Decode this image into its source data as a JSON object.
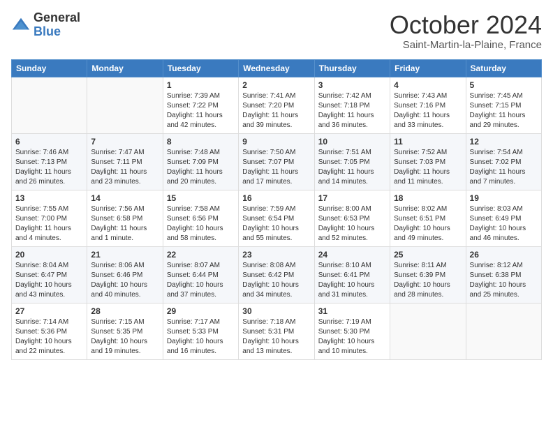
{
  "header": {
    "logo_general": "General",
    "logo_blue": "Blue",
    "month_title": "October 2024",
    "location": "Saint-Martin-la-Plaine, France"
  },
  "weekdays": [
    "Sunday",
    "Monday",
    "Tuesday",
    "Wednesday",
    "Thursday",
    "Friday",
    "Saturday"
  ],
  "weeks": [
    [
      {
        "day": "",
        "info": ""
      },
      {
        "day": "",
        "info": ""
      },
      {
        "day": "1",
        "info": "Sunrise: 7:39 AM\nSunset: 7:22 PM\nDaylight: 11 hours and 42 minutes."
      },
      {
        "day": "2",
        "info": "Sunrise: 7:41 AM\nSunset: 7:20 PM\nDaylight: 11 hours and 39 minutes."
      },
      {
        "day": "3",
        "info": "Sunrise: 7:42 AM\nSunset: 7:18 PM\nDaylight: 11 hours and 36 minutes."
      },
      {
        "day": "4",
        "info": "Sunrise: 7:43 AM\nSunset: 7:16 PM\nDaylight: 11 hours and 33 minutes."
      },
      {
        "day": "5",
        "info": "Sunrise: 7:45 AM\nSunset: 7:15 PM\nDaylight: 11 hours and 29 minutes."
      }
    ],
    [
      {
        "day": "6",
        "info": "Sunrise: 7:46 AM\nSunset: 7:13 PM\nDaylight: 11 hours and 26 minutes."
      },
      {
        "day": "7",
        "info": "Sunrise: 7:47 AM\nSunset: 7:11 PM\nDaylight: 11 hours and 23 minutes."
      },
      {
        "day": "8",
        "info": "Sunrise: 7:48 AM\nSunset: 7:09 PM\nDaylight: 11 hours and 20 minutes."
      },
      {
        "day": "9",
        "info": "Sunrise: 7:50 AM\nSunset: 7:07 PM\nDaylight: 11 hours and 17 minutes."
      },
      {
        "day": "10",
        "info": "Sunrise: 7:51 AM\nSunset: 7:05 PM\nDaylight: 11 hours and 14 minutes."
      },
      {
        "day": "11",
        "info": "Sunrise: 7:52 AM\nSunset: 7:03 PM\nDaylight: 11 hours and 11 minutes."
      },
      {
        "day": "12",
        "info": "Sunrise: 7:54 AM\nSunset: 7:02 PM\nDaylight: 11 hours and 7 minutes."
      }
    ],
    [
      {
        "day": "13",
        "info": "Sunrise: 7:55 AM\nSunset: 7:00 PM\nDaylight: 11 hours and 4 minutes."
      },
      {
        "day": "14",
        "info": "Sunrise: 7:56 AM\nSunset: 6:58 PM\nDaylight: 11 hours and 1 minute."
      },
      {
        "day": "15",
        "info": "Sunrise: 7:58 AM\nSunset: 6:56 PM\nDaylight: 10 hours and 58 minutes."
      },
      {
        "day": "16",
        "info": "Sunrise: 7:59 AM\nSunset: 6:54 PM\nDaylight: 10 hours and 55 minutes."
      },
      {
        "day": "17",
        "info": "Sunrise: 8:00 AM\nSunset: 6:53 PM\nDaylight: 10 hours and 52 minutes."
      },
      {
        "day": "18",
        "info": "Sunrise: 8:02 AM\nSunset: 6:51 PM\nDaylight: 10 hours and 49 minutes."
      },
      {
        "day": "19",
        "info": "Sunrise: 8:03 AM\nSunset: 6:49 PM\nDaylight: 10 hours and 46 minutes."
      }
    ],
    [
      {
        "day": "20",
        "info": "Sunrise: 8:04 AM\nSunset: 6:47 PM\nDaylight: 10 hours and 43 minutes."
      },
      {
        "day": "21",
        "info": "Sunrise: 8:06 AM\nSunset: 6:46 PM\nDaylight: 10 hours and 40 minutes."
      },
      {
        "day": "22",
        "info": "Sunrise: 8:07 AM\nSunset: 6:44 PM\nDaylight: 10 hours and 37 minutes."
      },
      {
        "day": "23",
        "info": "Sunrise: 8:08 AM\nSunset: 6:42 PM\nDaylight: 10 hours and 34 minutes."
      },
      {
        "day": "24",
        "info": "Sunrise: 8:10 AM\nSunset: 6:41 PM\nDaylight: 10 hours and 31 minutes."
      },
      {
        "day": "25",
        "info": "Sunrise: 8:11 AM\nSunset: 6:39 PM\nDaylight: 10 hours and 28 minutes."
      },
      {
        "day": "26",
        "info": "Sunrise: 8:12 AM\nSunset: 6:38 PM\nDaylight: 10 hours and 25 minutes."
      }
    ],
    [
      {
        "day": "27",
        "info": "Sunrise: 7:14 AM\nSunset: 5:36 PM\nDaylight: 10 hours and 22 minutes."
      },
      {
        "day": "28",
        "info": "Sunrise: 7:15 AM\nSunset: 5:35 PM\nDaylight: 10 hours and 19 minutes."
      },
      {
        "day": "29",
        "info": "Sunrise: 7:17 AM\nSunset: 5:33 PM\nDaylight: 10 hours and 16 minutes."
      },
      {
        "day": "30",
        "info": "Sunrise: 7:18 AM\nSunset: 5:31 PM\nDaylight: 10 hours and 13 minutes."
      },
      {
        "day": "31",
        "info": "Sunrise: 7:19 AM\nSunset: 5:30 PM\nDaylight: 10 hours and 10 minutes."
      },
      {
        "day": "",
        "info": ""
      },
      {
        "day": "",
        "info": ""
      }
    ]
  ]
}
